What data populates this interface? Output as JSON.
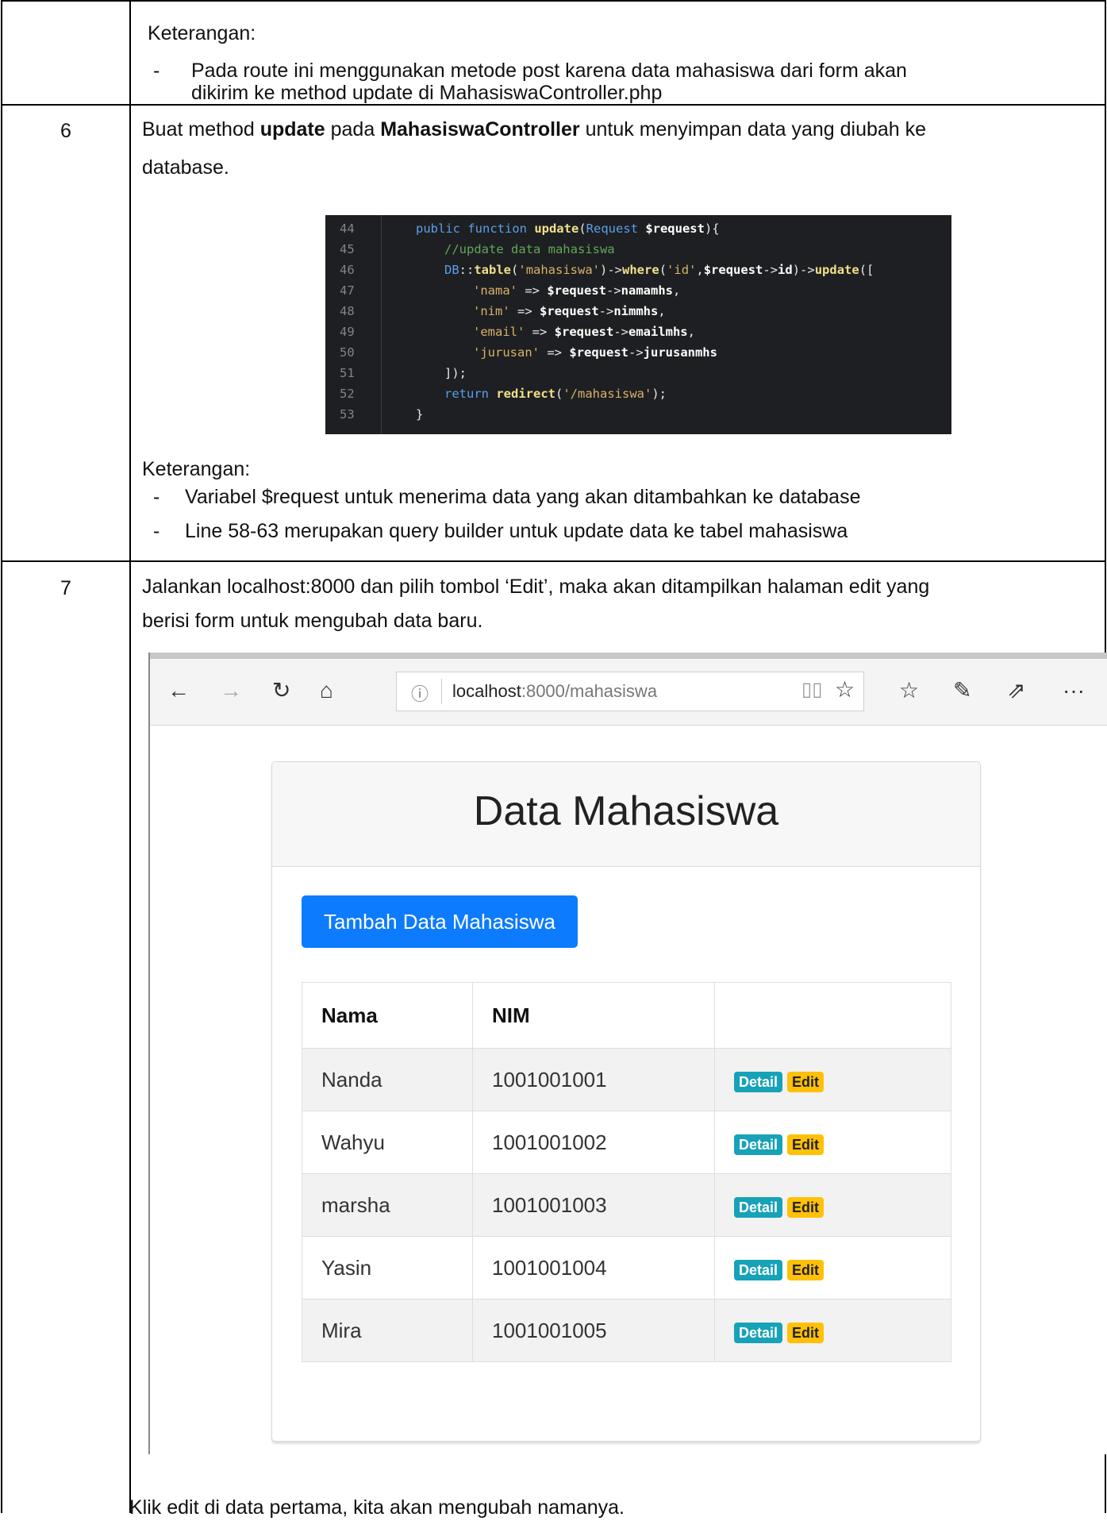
{
  "row5": {
    "note_title": "Keterangan:",
    "bullets": [
      "Pada route ini menggunakan metode post karena data mahasiswa dari form akan",
      "dikirim ke method update di MahasiswaController.php"
    ]
  },
  "row6": {
    "number": "6",
    "instr_part1": "Buat method ",
    "instr_bold1": "update",
    "instr_part2": " pada ",
    "instr_bold2": "MahasiswaController",
    "instr_part3": " untuk menyimpan data yang diubah ke",
    "instr_line2": "database.",
    "code_line_numbers": [
      "44",
      "45",
      "46",
      "47",
      "48",
      "49",
      "50",
      "51",
      "52",
      "53"
    ],
    "note_title": "Keterangan:",
    "bullets": [
      "Variabel $request untuk menerima data yang akan ditambahkan ke database",
      "Line 58-63 merupakan query builder untuk update data ke tabel mahasiswa"
    ]
  },
  "row7": {
    "number": "7",
    "instr_line1": "Jalankan localhost:8000 dan pilih tombol ‘Edit’, maka akan ditampilkan halaman edit yang",
    "instr_line2": "berisi form untuk mengubah data baru.",
    "footer_text": "Klik edit di data pertama, kita akan mengubah namanya."
  },
  "browser": {
    "url_host": "localhost",
    "url_rest": ":8000/mahasiswa",
    "icons": [
      "back-arrow-icon",
      "forward-arrow-icon",
      "refresh-icon",
      "home-icon",
      "info-icon",
      "reading-view-icon",
      "favorite-star-icon",
      "favorites-list-icon",
      "pen-icon",
      "share-icon",
      "more-icon"
    ]
  },
  "app": {
    "title": "Data Mahasiswa",
    "add_button": "Tambah Data Mahasiswa",
    "columns": [
      "Nama",
      "NIM",
      ""
    ],
    "rows": [
      {
        "nama": "Nanda",
        "nim": "1001001001"
      },
      {
        "nama": "Wahyu",
        "nim": "1001001002"
      },
      {
        "nama": "marsha",
        "nim": "1001001003"
      },
      {
        "nama": "Yasin",
        "nim": "1001001004"
      },
      {
        "nama": "Mira",
        "nim": "1001001005"
      }
    ],
    "detail_label": "Detail",
    "edit_label": "Edit"
  },
  "colors": {
    "primary": "#0d7bfd",
    "info": "#17a2b8",
    "warning": "#ffc107",
    "code_bg": "#1e1f22"
  }
}
